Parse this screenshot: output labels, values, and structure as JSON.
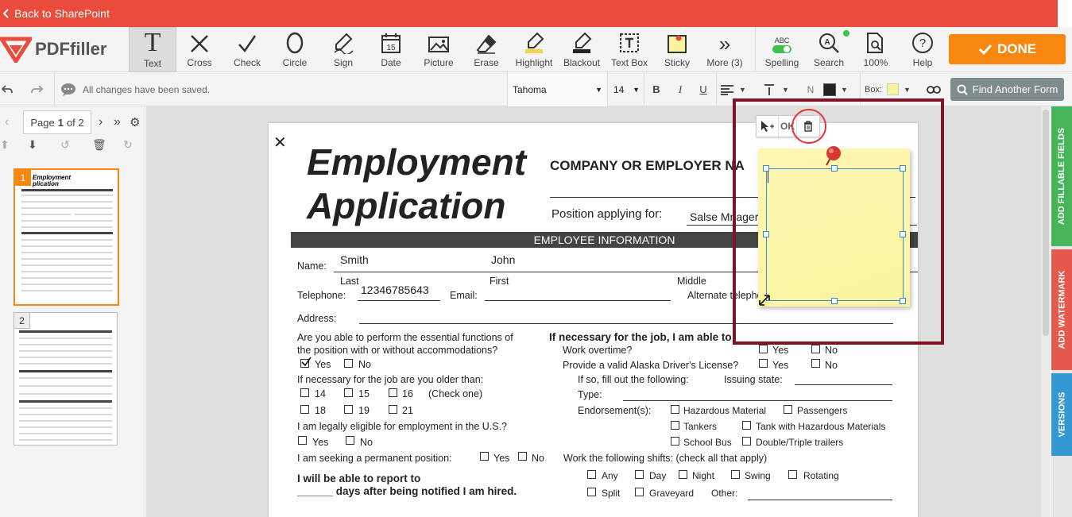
{
  "topbar": {
    "back_label": "Back to SharePoint"
  },
  "logo": {
    "brand": "PDFfiller"
  },
  "tools": [
    {
      "label": "Text",
      "icon": "text-icon"
    },
    {
      "label": "Cross",
      "icon": "cross-icon"
    },
    {
      "label": "Check",
      "icon": "check-icon"
    },
    {
      "label": "Circle",
      "icon": "circle-icon"
    },
    {
      "label": "Sign",
      "icon": "sign-icon"
    },
    {
      "label": "Date",
      "icon": "date-icon"
    },
    {
      "label": "Picture",
      "icon": "picture-icon"
    },
    {
      "label": "Erase",
      "icon": "erase-icon"
    },
    {
      "label": "Highlight",
      "icon": "highlight-icon"
    },
    {
      "label": "Blackout",
      "icon": "blackout-icon"
    },
    {
      "label": "Text Box",
      "icon": "text-box-icon"
    },
    {
      "label": "Sticky",
      "icon": "sticky-icon"
    },
    {
      "label": "More (3)",
      "icon": "more-icon"
    }
  ],
  "right_tools": {
    "spelling": "Spelling",
    "spelling_abc": "ABC",
    "search": "Search",
    "zoom": "100%",
    "help": "Help"
  },
  "done_label": "DONE",
  "secondbar": {
    "status": "All changes have been saved.",
    "font": "Tahoma",
    "font_size": "14",
    "bold": "B",
    "italic": "I",
    "underline": "U",
    "n": "N",
    "box_label": "Box:",
    "find_label": "Find Another Form"
  },
  "pager": {
    "prefix": "Page",
    "current": "1",
    "suffix": "of 2"
  },
  "thumbs": [
    "1",
    "2"
  ],
  "sticky": {
    "ok": "OK"
  },
  "rail": {
    "fillable": "ADD FILLABLE FIELDS",
    "watermark": "ADD WATERMARK",
    "versions": "VERSIONS"
  },
  "form": {
    "title1": "Employment",
    "title2": "Application",
    "company_label": "COMPANY OR EMPLOYER NA",
    "position_label": "Position applying for:",
    "position_value": "Salse Mnager",
    "section_title": "EMPLOYEE INFORMATION",
    "name_label": "Name:",
    "last_value": "Smith",
    "first_value": "John",
    "last_label": "Last",
    "first_label": "First",
    "middle_label": "Middle",
    "telephone_label": "Telephone:",
    "telephone_value": "12346785643",
    "email_label": "Email:",
    "alt_phone_label": "Alternate telephone:",
    "address_label": "Address:",
    "q_essential_1": "Are you able to perform the essential functions of",
    "q_essential_2": "the position with or without accommodations?",
    "yes": "Yes",
    "no": "No",
    "q_older": "If necessary for the job are you older than:",
    "ages": [
      "14",
      "15",
      "16",
      "18",
      "19",
      "21"
    ],
    "check_one": "(Check one)",
    "q_legal": "I am legally eligible for employment in the U.S.?",
    "q_permanent": "I am seeking a permanent position:",
    "report_1": "I will be able to report to",
    "report_2": "______ days after being notified I am hired.",
    "able_header": "If necessary for the job, I am able to:",
    "overtime": "Work overtime?",
    "license": "Provide a valid Alaska Driver's License?",
    "fill_out": "If so, fill out the following:",
    "issuing": "Issuing state:",
    "type": "Type:",
    "endorse": "Endorsement(s):",
    "endorse_opts": [
      "Hazardous Material",
      "Passengers",
      "Tankers",
      "Tank with Hazardous Materials",
      "School Bus",
      "Double/Triple trailers"
    ],
    "shifts": "Work the following shifts: (check all that apply)",
    "shift_opts": [
      "Any",
      "Day",
      "Night",
      "Swing",
      "Rotating",
      "Split",
      "Graveyard"
    ],
    "other": "Other:"
  }
}
